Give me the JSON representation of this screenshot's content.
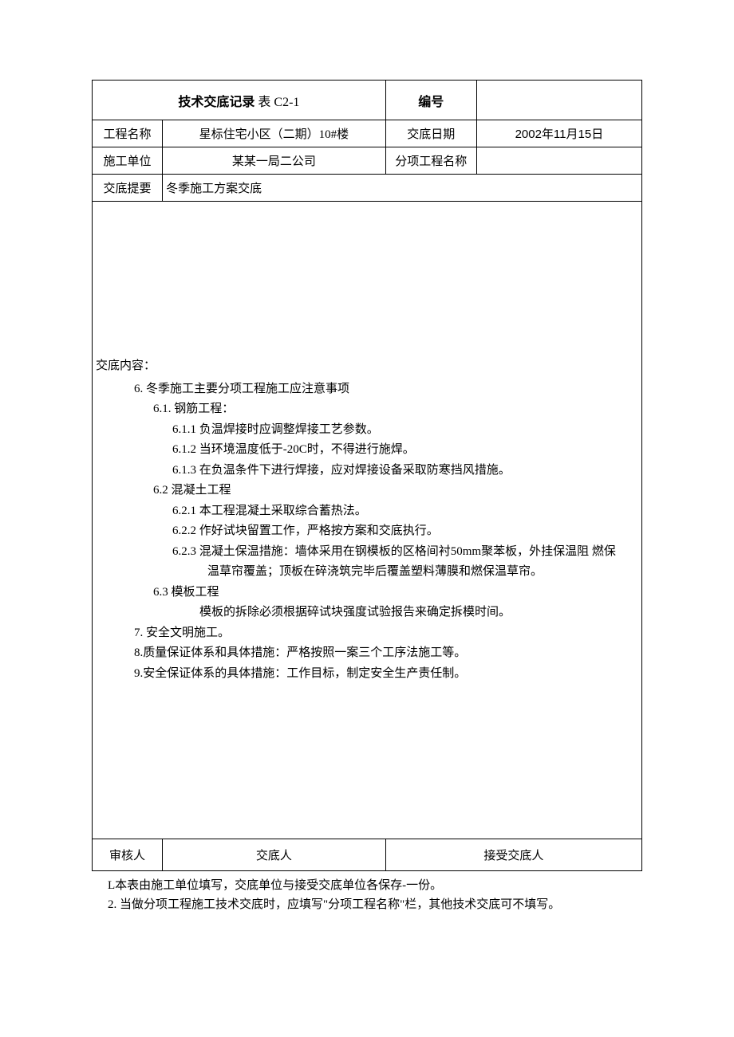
{
  "header": {
    "title_label": "技术交底记录",
    "title_code": "表 C2-1",
    "number_label": "编号",
    "number_value": "",
    "project_name_label": "工程名称",
    "project_name_value": "星标住宅小区（二期）10#楼",
    "date_label": "交底日期",
    "date_value": "2002年11月15日",
    "unit_label": "施工单位",
    "unit_value": "某某一局二公司",
    "subproject_label": "分项工程名称",
    "subproject_value": "",
    "summary_label": "交底提要",
    "summary_value": "冬季施工方案交底"
  },
  "content": {
    "heading": "交底内容：",
    "s6": "6. 冬季施工主要分项工程施工应注意事项",
    "s6_1": "6.1. 钢筋工程：",
    "s6_1_1": "6.1.1 负温焊接时应调整焊接工艺参数。",
    "s6_1_2": "6.1.2 当环境温度低于-20C时，不得进行施焊。",
    "s6_1_3": "6.1.3 在负温条件下进行焊接，应对焊接设备采取防寒挡风措施。",
    "s6_2": "6.2 混凝土工程",
    "s6_2_1": "6.2.1 本工程混凝土采取综合蓄热法。",
    "s6_2_2": "6.2.2 作好试块留置工作，严格按方案和交底执行。",
    "s6_2_3_a": "6.2.3 混凝土保温措施：墙体采用在钢模板的区格间衬50mm聚苯板，外挂保温阻 燃保",
    "s6_2_3_b": "温草帘覆盖；顶板在碎浇筑完毕后覆盖塑料薄膜和燃保温草帘。",
    "s6_3": "6.3 模板工程",
    "s6_3_1": "模板的拆除必须根据碎试块强度试验报告来确定拆模时间。",
    "s7": "7. 安全文明施工。",
    "s8": "8.质量保证体系和具体措施：严格按照一案三个工序法施工等。",
    "s9": "9.安全保证体系的具体措施：工作目标，制定安全生产责任制。"
  },
  "footer": {
    "reviewer_label": "审核人",
    "discloser_label": "交底人",
    "receiver_label": "接受交底人"
  },
  "notes": {
    "n1": "L本表由施工单位填写，交底单位与接受交底单位各保存-一份。",
    "n2": "2. 当做分项工程施工技术交底时，应填写\"分项工程名称\"栏，其他技术交底可不填写。"
  }
}
